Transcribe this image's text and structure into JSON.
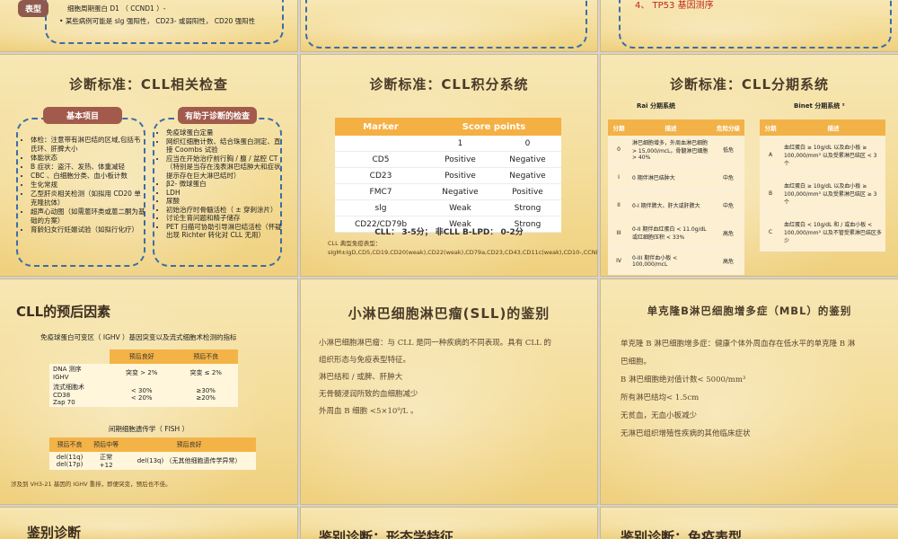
{
  "top_row": {
    "s1": {
      "tag": "表型",
      "line1": "细胞周期蛋白 D1 （ CCND1 ）-",
      "line2": "某些病例可能是 slg 强阳性， CD23- 或弱阳性， CD20 强阳性"
    },
    "s3": {
      "line": "4、 TP53 基因测序"
    }
  },
  "tests": {
    "title": "诊断标准：CLL相关检查",
    "basic_tag": "基本项目",
    "helpful_tag": "有助于诊断的检查",
    "basic_items": [
      "体检：注意带有淋巴结的区域,包括韦氏环、肝脾大小",
      "体能状态",
      "B 症状：盗汗、发热、体重减轻",
      "CBC 、白细胞分类、血小板计数",
      "生化常规",
      "乙型肝炎相关检测（如拟用 CD20 单克隆抗体）",
      "超声心动图（如需蒽环类或蒽二酮为基础的方案）",
      "育龄妇女行妊娠试验（如拟行化疗）"
    ],
    "helpful_items": [
      "免疫球蛋白定量",
      "网织红细胞计数、结合珠蛋白测定、直接 Coombs 试验",
      "应当在开始治疗前行胸 / 腹 / 盆腔 CT （特别是当存在浅表淋巴结肿大和症状提示存在巨大淋巴结时）",
      "β2- 微球蛋白",
      "LDH",
      "尿酸",
      "初始治疗时骨髓活检（ ± 穿刺涂片）",
      "讨论生育问题和精子储存",
      "PET 扫描可协助引导淋巴结活检（怀疑出现 Richter 转化对 CLL 无用）"
    ]
  },
  "score": {
    "title": "诊断标准：CLL积分系统",
    "headers": [
      "Marker",
      "Score points"
    ],
    "rows": [
      [
        "",
        "1",
        "0"
      ],
      [
        "CD5",
        "Positive",
        "Negative"
      ],
      [
        "CD23",
        "Positive",
        "Negative"
      ],
      [
        "FMC7",
        "Negative",
        "Positive"
      ],
      [
        "slg",
        "Weak",
        "Strong"
      ],
      [
        "CD22/CD79b",
        "Weak",
        "Strong"
      ]
    ],
    "summary": "CLL： 3-5分； 非CLL B-LPD： 0-2分",
    "note": "CLL 典型免疫表型： sIgM±IgD,CD5,CD19,CD20(weak),CD22(weak),CD79a,CD23,CD43,CD11c(weak),CD10-,CCND1-,FMC7±,CD79b±"
  },
  "staging": {
    "title": "诊断标准：CLL分期系统",
    "rai_title": "Rai 分期系统",
    "binet_title": "Binet 分期系统 ²",
    "rai_headers": [
      "分期",
      "描述",
      "危险分级"
    ],
    "rai_rows": [
      [
        "0",
        "淋巴细胞增多，外周血淋巴细胞 > 15,000/mcL，骨髓淋巴细胞 > 40%",
        "低危"
      ],
      [
        "I",
        "0 期伴淋巴结肿大",
        "中危"
      ],
      [
        "II",
        "0-I 期伴脾大、肝大或肝脾大",
        "中危"
      ],
      [
        "III",
        "0-II 期伴血红蛋白 < 11.0g/dL 或红细胞压积 < 33%",
        "高危"
      ],
      [
        "IV",
        "0-III 期伴血小板 < 100,000/mcL",
        "高危"
      ]
    ],
    "binet_headers": [
      "分期",
      "描述"
    ],
    "binet_rows": [
      [
        "A",
        "血红蛋白 ≥ 10g/dL 以及血小板 ≥ 100,000/mm³ 以及受累淋巴结区 < 3 个"
      ],
      [
        "B",
        "血红蛋白 ≥ 10g/dL 以及血小板 ≥ 100,000/mm³ 以及受累淋巴结区 ≥ 3 个"
      ],
      [
        "C",
        "血红蛋白 < 10g/dL 和 / 或血小板 < 100,000/mm³ 以及不管受累淋巴结区多少"
      ]
    ]
  },
  "prognosis": {
    "title": "CLL的预后因素",
    "subtitle": "免疫球蛋白可变区（ IGHV ）基因突变以及流式细胞术检测的指标",
    "t1_headers": [
      "",
      "预后良好",
      "预后不良"
    ],
    "t1_rows": [
      [
        "DNA 测序\nIGHV",
        "突变 > 2%",
        "突变 ≤ 2%"
      ],
      [
        "流式细胞术\nCD38\nZap 70",
        "< 30%\n< 20%",
        "≥30%\n≥20%"
      ]
    ],
    "fish_title": "间期细胞遗传学（ FISH ）",
    "t2_headers": [
      "预后不良",
      "预后中等",
      "预后良好"
    ],
    "t2_rows": [
      [
        "del(11q)\ndel(17p)",
        "正常\n+12",
        "del(13q) （无其他细胞遗传学异常）"
      ]
    ],
    "note": "涉及到 VH3-21 基因的 IGHV 重排，即便突变，预后也不佳。"
  },
  "sll": {
    "title": "小淋巴细胞淋巴瘤(SLL)的鉴别",
    "lines": [
      "小淋巴细胞淋巴瘤：与 CLL 是同一种疾病的不同表现。具有 CLL 的",
      "组织形态与免疫表型特征。",
      "淋巴结和 / 或脾、肝肿大",
      "无骨髓浸润所致的血细胞减少",
      "外周血 B 细胞 <5×10⁹/L 。"
    ]
  },
  "mbl": {
    "title": "单克隆B淋巴细胞增多症（MBL）的鉴别",
    "lines": [
      "单克隆 B 淋巴细胞增多症：健康个体外周血存在低水平的单克隆 B 淋",
      "巴细胞。",
      "B 淋巴细胞绝对值计数< 5000/mm³",
      "所有淋巴结均< 1.5cm",
      "无贫血，无血小板减少",
      "无淋巴组织增殖性疾病的其他临床症状"
    ]
  },
  "bottom": {
    "s1": "鉴别诊断",
    "s2": "鉴别诊断：形态学特征",
    "s3": "鉴别诊断：免疫表型"
  }
}
